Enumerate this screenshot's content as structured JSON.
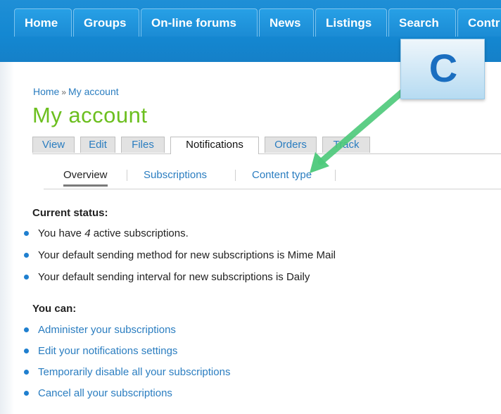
{
  "nav": {
    "tabs": [
      "Home",
      "Groups",
      "On-line forums",
      "News",
      "Listings",
      "Search",
      "Contr"
    ]
  },
  "breadcrumb": {
    "home": "Home",
    "separator": "»",
    "current": "My account"
  },
  "page_title": "My account",
  "tabs": [
    "View",
    "Edit",
    "Files",
    "Notifications",
    "Orders",
    "Track"
  ],
  "active_tab": "Notifications",
  "subtabs": [
    "Overview",
    "Subscriptions",
    "Content type"
  ],
  "active_subtab": "Overview",
  "status": {
    "heading": "Current status:",
    "line1_prefix": "You have ",
    "line1_count": "4",
    "line1_suffix": " active subscriptions.",
    "line2": "Your default sending method for new subscriptions is Mime Mail",
    "line3": "Your default sending interval for new subscriptions is Daily"
  },
  "you_can": {
    "heading": "You can:",
    "links": [
      "Administer your subscriptions",
      "Edit your notifications settings",
      "Temporarily disable all your subscriptions",
      "Cancel all your subscriptions"
    ]
  },
  "annotation": {
    "letter": "C",
    "arrow_color": "#4cc97a"
  },
  "colors": {
    "nav_blue": "#1a8ad4",
    "title_green": "#6cbf1f",
    "link_blue": "#2a7dc0"
  }
}
